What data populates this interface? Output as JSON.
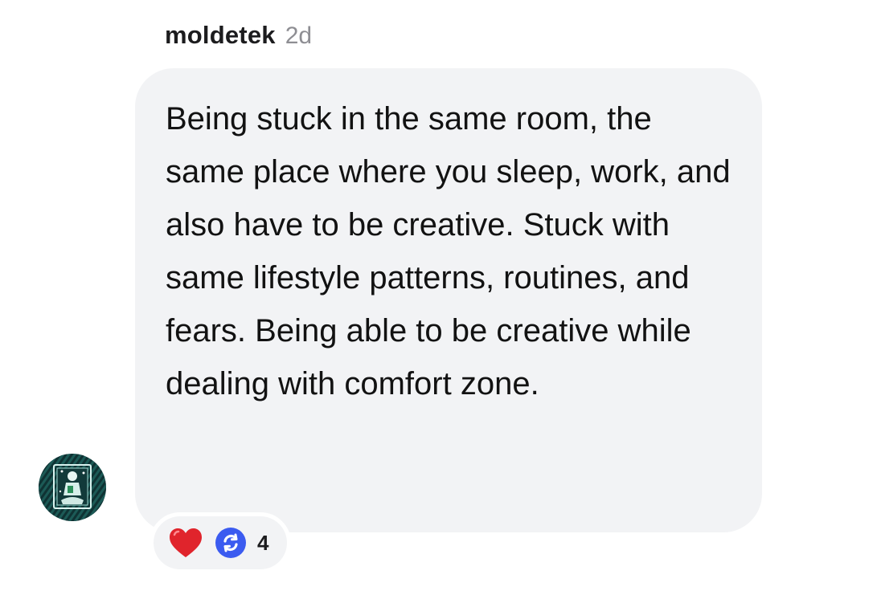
{
  "comment": {
    "username": "moldetek",
    "timestamp": "2d",
    "text": "Being stuck in the same room, the same place where you sleep, work, and also have to be creative. Stuck with same lifestyle patterns, routines, and fears. Being able to be creative while dealing with comfort zone."
  },
  "avatar": {
    "icon": "user-avatar-illustration",
    "background_color": "#12393a"
  },
  "reactions": {
    "items": [
      {
        "icon": "red-heart-icon",
        "color": "#e0242c"
      },
      {
        "icon": "repost-icon",
        "color": "#3b5bf0"
      }
    ],
    "count": "4"
  },
  "colors": {
    "bubble": "#f2f3f5",
    "text": "#121212",
    "timestamp": "#8e8e93"
  }
}
